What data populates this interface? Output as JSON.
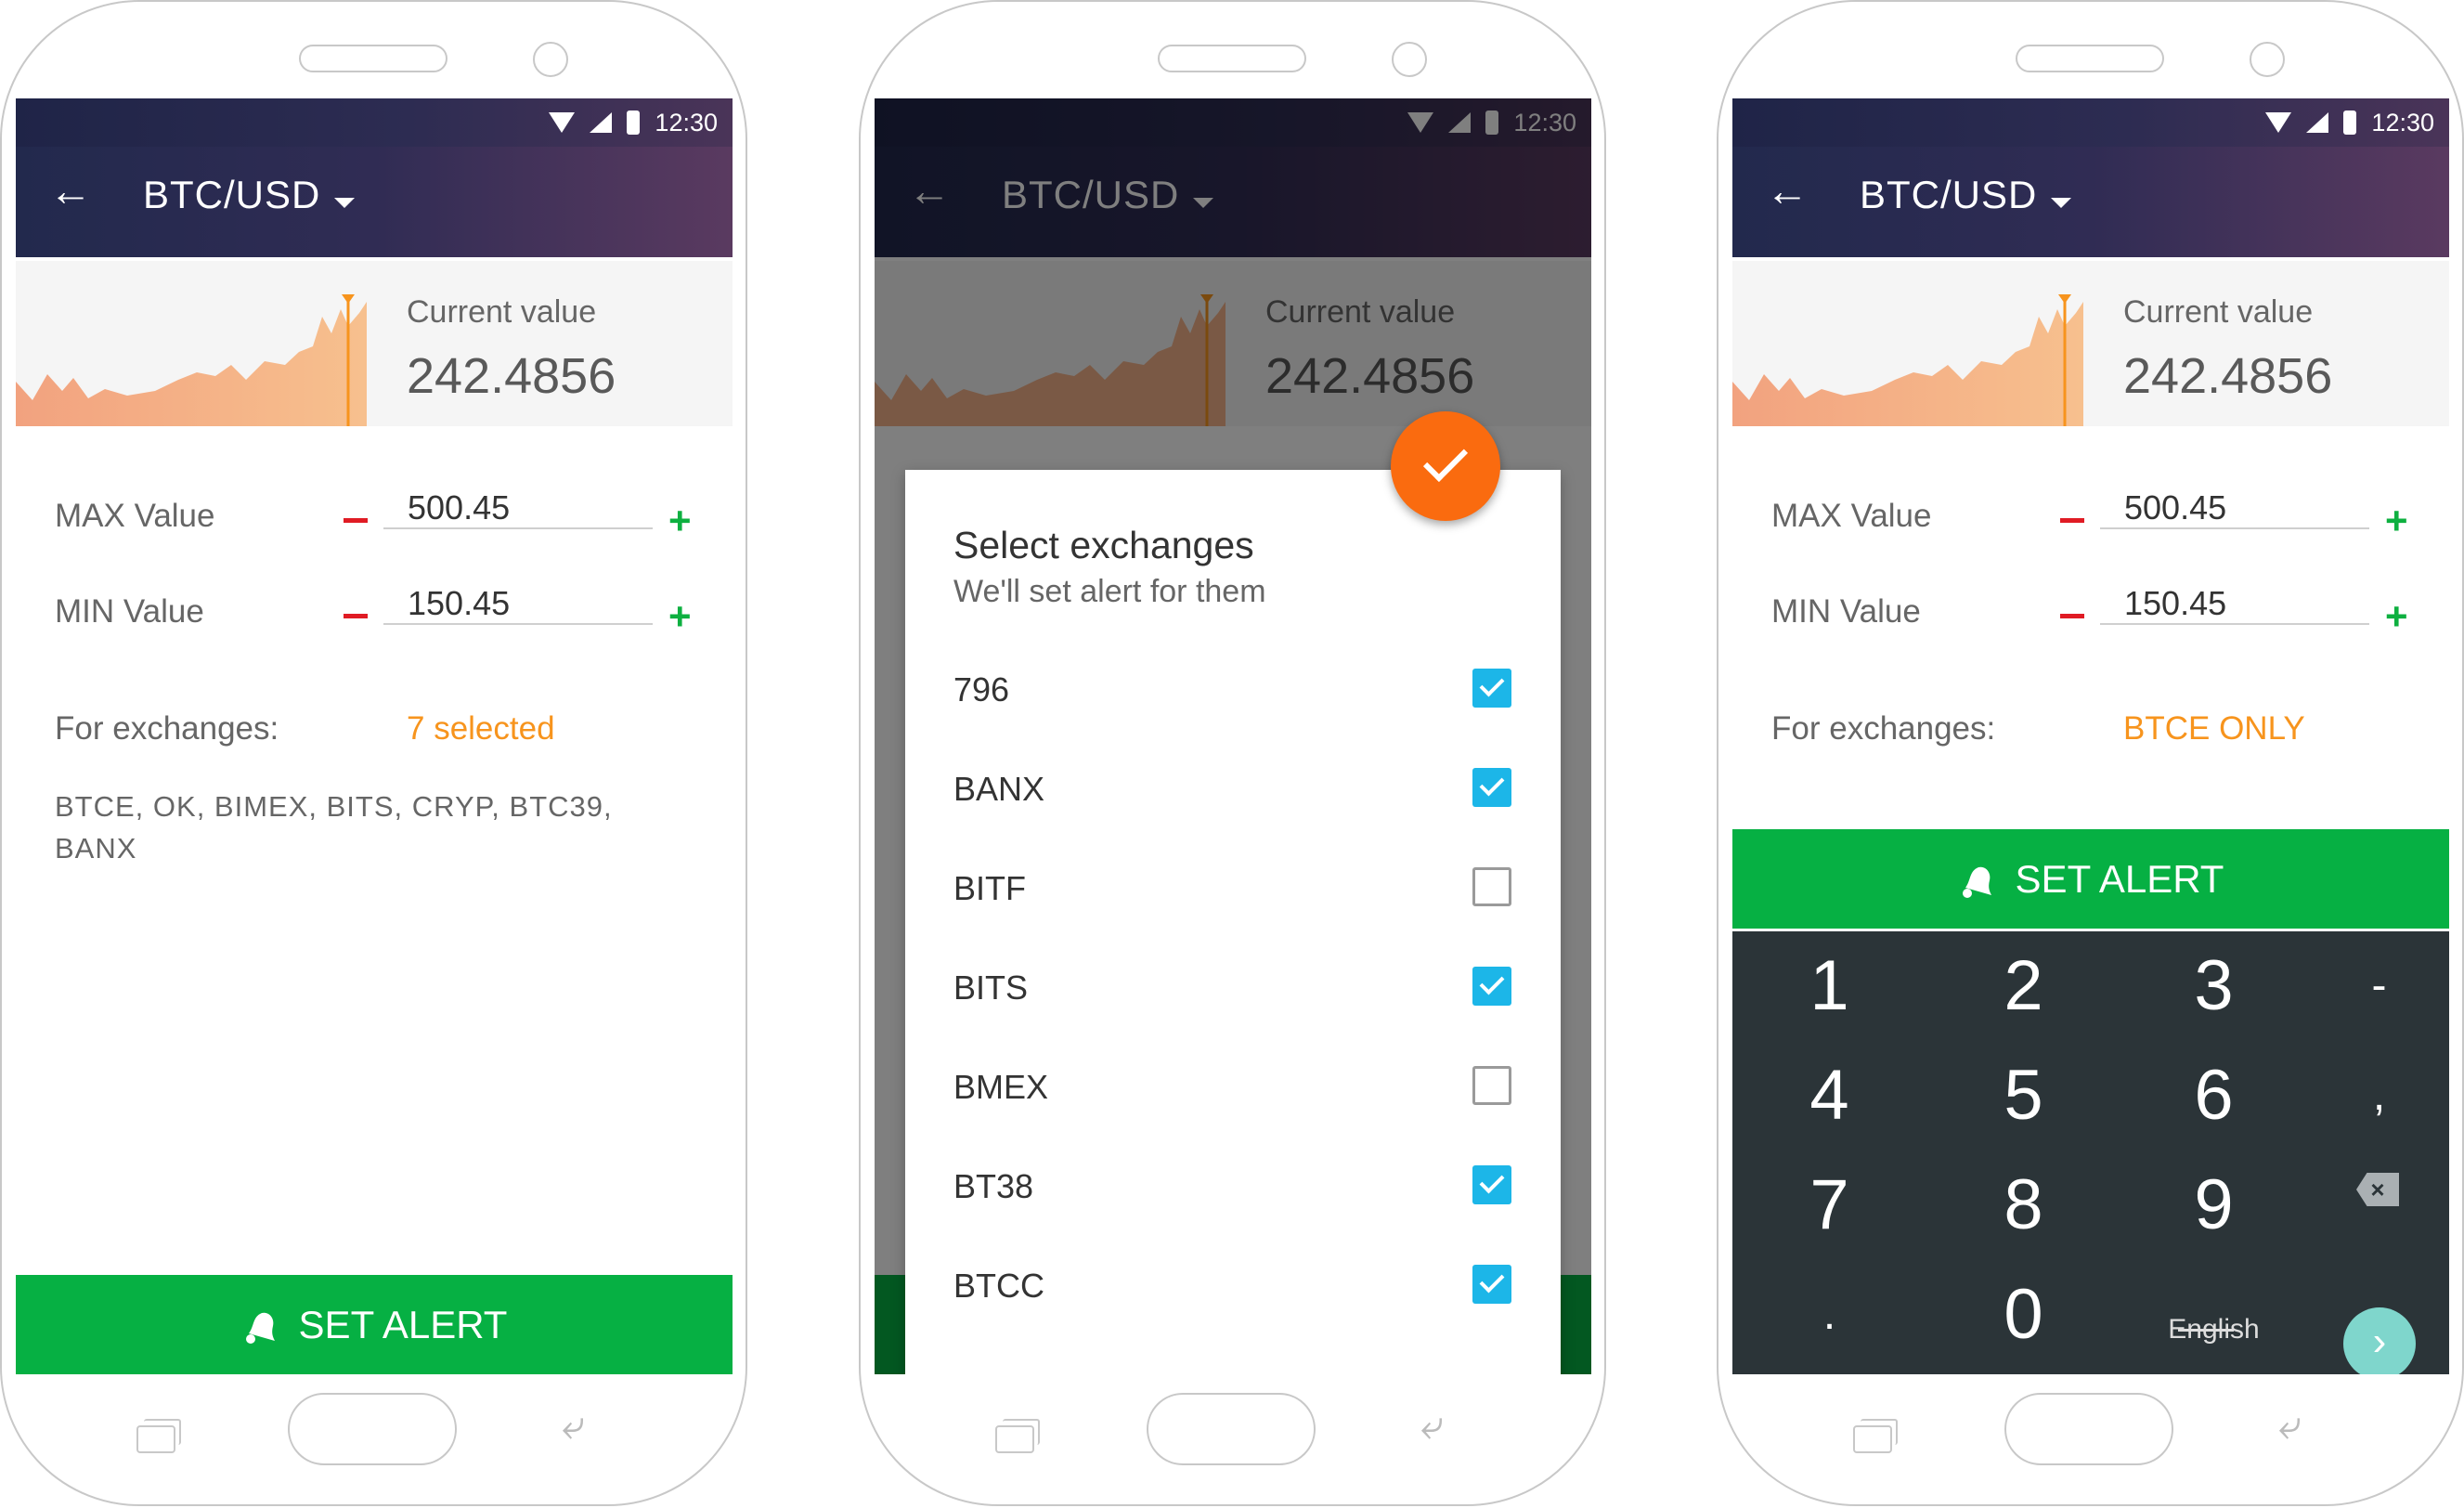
{
  "status": {
    "time": "12:30"
  },
  "header": {
    "pair": "BTC/USD"
  },
  "card": {
    "label": "Current value",
    "value": "242.4856"
  },
  "fields": {
    "max_label": "MAX Value",
    "max_value": "500.45",
    "min_label": "MIN Value",
    "min_value": "150.45"
  },
  "exchanges": {
    "label": "For exchanges:",
    "selected_summary": "7 selected",
    "selected_list": "BTCE, OK, BIMEX, BITS, CRYP, BTC39, BANX",
    "only_value": "BTCE ONLY"
  },
  "action": {
    "set_alert": "SET ALERT"
  },
  "dialog": {
    "title": "Select exchanges",
    "subtitle": "We'll set alert for them",
    "items": [
      {
        "name": "796",
        "checked": true
      },
      {
        "name": "BANX",
        "checked": true
      },
      {
        "name": "BITF",
        "checked": false
      },
      {
        "name": "BITS",
        "checked": true
      },
      {
        "name": "BMEX",
        "checked": false
      },
      {
        "name": "BT38",
        "checked": true
      },
      {
        "name": "BTCC",
        "checked": true
      }
    ]
  },
  "keypad": {
    "keys": [
      "1",
      "2",
      "3",
      "-",
      "4",
      "5",
      "6",
      ",",
      "7",
      "8",
      "9",
      ".",
      "0"
    ],
    "language": "English"
  },
  "colors": {
    "accent_orange": "#f7941d",
    "alert_green": "#06b043",
    "minus_red": "#e01b24",
    "plus_green": "#0eb040",
    "check_blue": "#1cb6e8",
    "fab_orange": "#fa6b0f"
  }
}
